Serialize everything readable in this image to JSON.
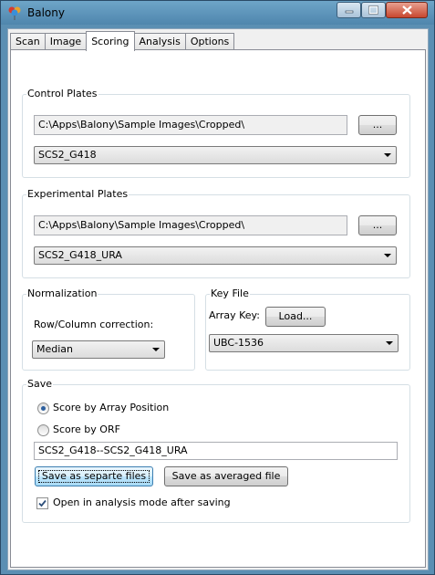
{
  "window": {
    "title": "Balony"
  },
  "tabs": [
    "Scan",
    "Image",
    "Scoring",
    "Analysis",
    "Options"
  ],
  "active_tab": "Scoring",
  "control_plates": {
    "title": "Control Plates",
    "path": "C:\\Apps\\Balony\\Sample Images\\Cropped\\",
    "browse_label": "...",
    "selected": "SCS2_G418"
  },
  "experimental_plates": {
    "title": "Experimental Plates",
    "path": "C:\\Apps\\Balony\\Sample Images\\Cropped\\",
    "browse_label": "...",
    "selected": "SCS2_G418_URA"
  },
  "normalization": {
    "title": "Normalization",
    "label": "Row/Column correction:",
    "selected": "Median"
  },
  "key_file": {
    "title": "Key File",
    "array_key_label": "Array Key:",
    "load_label": "Load...",
    "selected": "UBC-1536"
  },
  "save": {
    "title": "Save",
    "options": [
      "Score by Array Position",
      "Score by ORF"
    ],
    "selected_option": "Score by Array Position",
    "filename": "SCS2_G418--SCS2_G418_URA",
    "separate_label": "Save as separte files",
    "averaged_label": "Save as averaged file",
    "open_checkbox_label": "Open in analysis mode after saving",
    "open_checked": true
  }
}
